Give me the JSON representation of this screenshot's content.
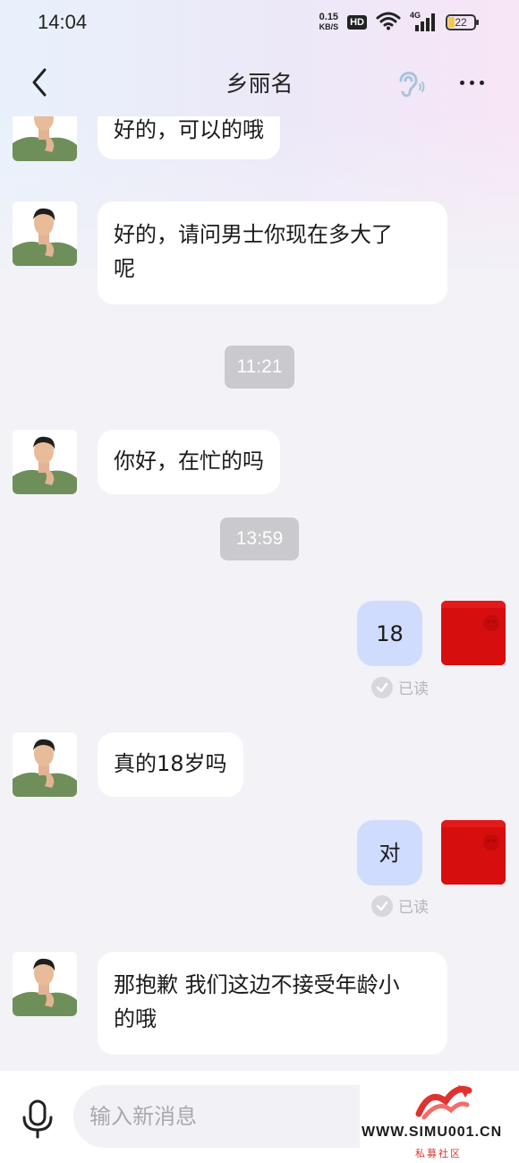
{
  "status_bar": {
    "time": "14:04",
    "net_speed_value": "0.15",
    "net_speed_unit": "KB/S",
    "hd_label": "HD",
    "network_label": "4G",
    "battery_level": "22"
  },
  "header": {
    "title": "乡丽名"
  },
  "messages": [
    {
      "text": "好的，可以的哦"
    },
    {
      "line1": "好的，请问男士你现在多大了",
      "line2": "呢"
    },
    {
      "time": "11:21"
    },
    {
      "text": "你好，在忙的吗"
    },
    {
      "time": "13:59"
    },
    {
      "text": "18",
      "status": "已读"
    },
    {
      "text": "真的18岁吗"
    },
    {
      "text": "对",
      "status": "已读"
    },
    {
      "line1": "那抱歉 我们这边不接受年龄小",
      "line2": "的哦"
    }
  ],
  "input": {
    "placeholder": "输入新消息"
  },
  "watermark": {
    "site": "WWW.SIMU001.CN",
    "caption": "私募社区"
  },
  "colors": {
    "outgoing_bubble": "#cfdcfd",
    "incoming_bubble": "#ffffff",
    "time_chip": "#c9c9ce",
    "my_avatar": "#d70e0e",
    "watermark_accent": "#e0322f"
  }
}
